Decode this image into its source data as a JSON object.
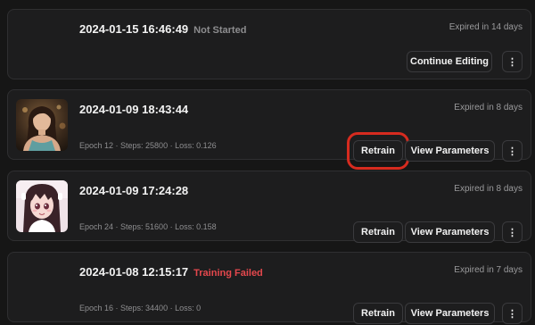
{
  "jobs": [
    {
      "timestamp": "2024-01-15 16:46:49",
      "status": "Not Started",
      "expiry": "Expired in 14 days",
      "stats": "",
      "primary_label": "Continue Editing",
      "more_label": "⋮"
    },
    {
      "timestamp": "2024-01-09 18:43:44",
      "status": "",
      "expiry": "Expired in 8 days",
      "stats": "Epoch 12 · Steps: 25800 · Loss: 0.126",
      "primary_label": "Retrain",
      "secondary_label": "View Parameters",
      "more_label": "⋮"
    },
    {
      "timestamp": "2024-01-09 17:24:28",
      "status": "",
      "expiry": "Expired in 8 days",
      "stats": "Epoch 24 · Steps: 51600 · Loss: 0.158",
      "primary_label": "Retrain",
      "secondary_label": "View Parameters",
      "more_label": "⋮"
    },
    {
      "timestamp": "2024-01-08 12:15:17",
      "status": "Training Failed",
      "expiry": "Expired in 7 days",
      "stats": "Epoch 16 · Steps: 34400 · Loss: 0",
      "primary_label": "Retrain",
      "secondary_label": "View Parameters",
      "more_label": "⋮"
    }
  ],
  "colors": {
    "background": "#161616",
    "card": "#1d1d1e",
    "error_status": "#e5484d",
    "highlight_ring": "#d62b1f"
  }
}
